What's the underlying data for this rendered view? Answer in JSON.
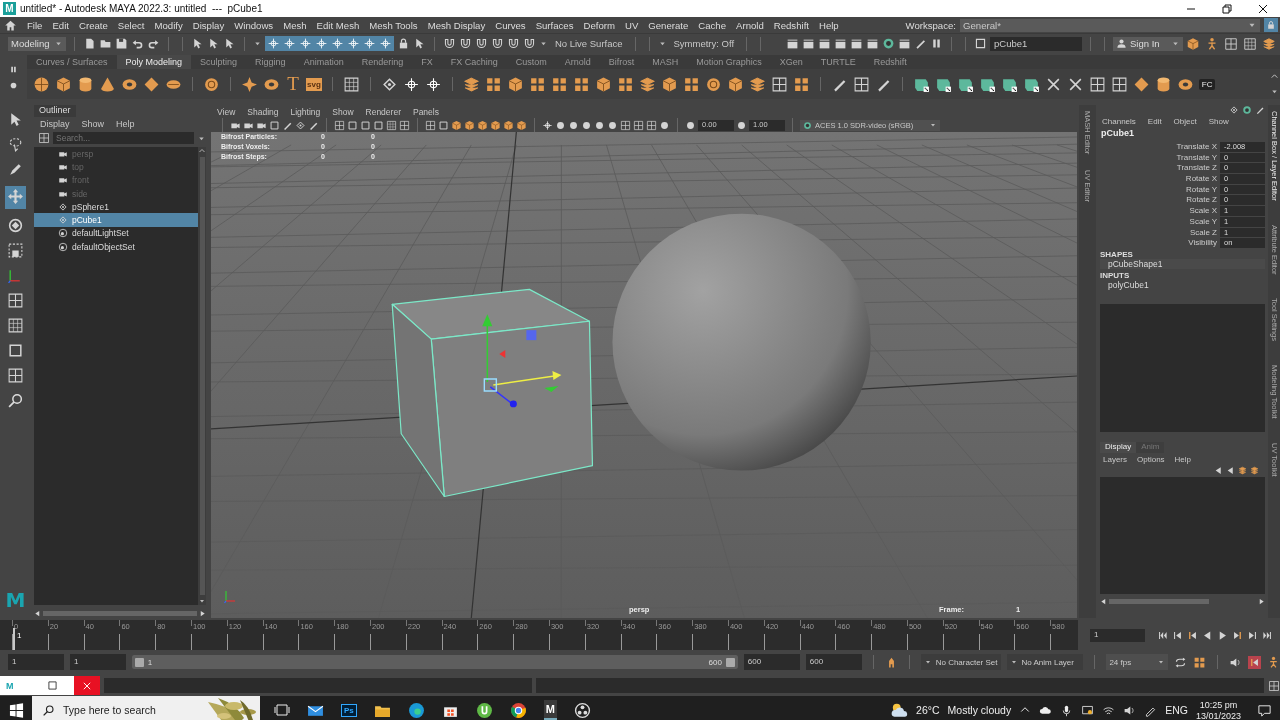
{
  "title_bar": {
    "logo": "M",
    "title": "untitled* - Autodesk MAYA 2022.3: untitled  ---  pCube1"
  },
  "menu_bar": {
    "items": [
      "File",
      "Edit",
      "Create",
      "Select",
      "Modify",
      "Display",
      "Windows",
      "Mesh",
      "Edit Mesh",
      "Mesh Tools",
      "Mesh Display",
      "Curves",
      "Surfaces",
      "Deform",
      "UV",
      "Generate",
      "Cache",
      "Arnold",
      "Redshift",
      "Help"
    ],
    "workspace_label": "Workspace:",
    "workspace": "General*"
  },
  "status_line": {
    "menu_set": "Modeling",
    "live_surface": "No Live Surface",
    "symmetry": "Symmetry: Off",
    "name_field": "pCube1",
    "sign_in": "Sign In"
  },
  "shelf": {
    "tabs": [
      {
        "label": "Curves / Surfaces",
        "selected": false
      },
      {
        "label": "Poly Modeling",
        "selected": true
      },
      {
        "label": "Sculpting",
        "selected": false
      },
      {
        "label": "Rigging",
        "selected": false
      },
      {
        "label": "Animation",
        "selected": false
      },
      {
        "label": "Rendering",
        "selected": false
      },
      {
        "label": "FX",
        "selected": false
      },
      {
        "label": "FX Caching",
        "selected": false
      },
      {
        "label": "Custom",
        "selected": false
      },
      {
        "label": "Arnold",
        "selected": false
      },
      {
        "label": "Bifrost",
        "selected": false
      },
      {
        "label": "MASH",
        "selected": false
      },
      {
        "label": "Motion Graphics",
        "selected": false
      },
      {
        "label": "XGen",
        "selected": false
      },
      {
        "label": "TURTLE",
        "selected": false
      },
      {
        "label": "Redshift",
        "selected": false
      }
    ],
    "type_label": "T",
    "svg_label": "svg",
    "fc_label": "FC"
  },
  "toolbox": {
    "logo": "M"
  },
  "outliner": {
    "title": "Outliner",
    "menus": [
      "Display",
      "Show",
      "Help"
    ],
    "search": {
      "placeholder": "Search..."
    },
    "items": [
      {
        "label": "persp",
        "kind": "camera",
        "hidden": true,
        "selected": false
      },
      {
        "label": "top",
        "kind": "camera",
        "hidden": true,
        "selected": false
      },
      {
        "label": "front",
        "kind": "camera",
        "hidden": true,
        "selected": false
      },
      {
        "label": "side",
        "kind": "camera",
        "hidden": true,
        "selected": false
      },
      {
        "label": "pSphere1",
        "kind": "transform",
        "hidden": false,
        "selected": false
      },
      {
        "label": "pCube1",
        "kind": "transform",
        "hidden": false,
        "selected": true
      },
      {
        "label": "defaultLightSet",
        "kind": "set",
        "hidden": false,
        "selected": false
      },
      {
        "label": "defaultObjectSet",
        "kind": "set",
        "hidden": false,
        "selected": false
      }
    ]
  },
  "viewport": {
    "menus": [
      "View",
      "Shading",
      "Lighting",
      "Show",
      "Renderer",
      "Panels"
    ],
    "exposure": "0.00",
    "gamma": "1.00",
    "color_space": "ACES 1.0 SDR-video (sRGB)",
    "hud": [
      {
        "label": "Bifrost Particles:",
        "values": [
          "0",
          "0"
        ]
      },
      {
        "label": "Bifrost Voxels:",
        "values": [
          "0",
          "0"
        ]
      },
      {
        "label": "Bifrost Steps:",
        "values": [
          "0",
          "0"
        ]
      }
    ],
    "camera": "persp",
    "frame_label": "Frame:",
    "frame": "1"
  },
  "side_tabs_left": [
    "MASH Editor",
    "UV Editor"
  ],
  "channel_box": {
    "menus": [
      "Channels",
      "Edit",
      "Object",
      "Show"
    ],
    "object": "pCube1",
    "attributes": [
      {
        "name": "Translate X",
        "value": "-2.008"
      },
      {
        "name": "Translate Y",
        "value": "0"
      },
      {
        "name": "Translate Z",
        "value": "0"
      },
      {
        "name": "Rotate X",
        "value": "0"
      },
      {
        "name": "Rotate Y",
        "value": "0"
      },
      {
        "name": "Rotate Z",
        "value": "0"
      },
      {
        "name": "Scale X",
        "value": "1"
      },
      {
        "name": "Scale Y",
        "value": "1"
      },
      {
        "name": "Scale Z",
        "value": "1"
      },
      {
        "name": "Visibility",
        "value": "on"
      }
    ],
    "shapes_heading": "SHAPES",
    "shapes": [
      "pCubeShape1"
    ],
    "inputs_heading": "INPUTS",
    "inputs": [
      "polyCube1"
    ]
  },
  "layer_editor": {
    "tabs": [
      {
        "label": "Display",
        "selected": true
      },
      {
        "label": "Anim",
        "selected": false
      }
    ],
    "menus": [
      "Layers",
      "Options",
      "Help"
    ]
  },
  "side_tabs_right": [
    {
      "label": "Channel Box / Layer Editor",
      "selected": true
    },
    {
      "label": "Attribute Editor",
      "selected": false
    },
    {
      "label": "Tool Settings",
      "selected": false
    },
    {
      "label": "Modeling Toolkit",
      "selected": false
    },
    {
      "label": "UV Toolkit",
      "selected": false
    }
  ],
  "time_slider": {
    "ticks": [
      "0",
      "20",
      "40",
      "60",
      "80",
      "100",
      "120",
      "140",
      "160",
      "180",
      "200",
      "220",
      "240",
      "260",
      "280",
      "300",
      "320",
      "340",
      "360",
      "380",
      "400",
      "420",
      "440",
      "460",
      "480",
      "500",
      "520",
      "540",
      "560",
      "580"
    ],
    "current_frame": "1",
    "level": 0.002,
    "frame_field": "1"
  },
  "range_slider": {
    "level": 1,
    "start": "1",
    "playback_start": "1",
    "range_start": "1",
    "range_end": "600",
    "playback_end": "600",
    "end": "600",
    "character_set": "No Character Set",
    "anim_layer": "No Anim Layer",
    "fps": "24 fps"
  },
  "command_line": {
    "logo": "M"
  },
  "taskbar": {
    "search_placeholder": "Type here to search",
    "ps_label": "Ps",
    "maya_label": "M",
    "temperature": "26°C",
    "weather": "Mostly cloudy",
    "language": "ENG",
    "time": "10:25 pm",
    "date": "13/01/2023"
  }
}
